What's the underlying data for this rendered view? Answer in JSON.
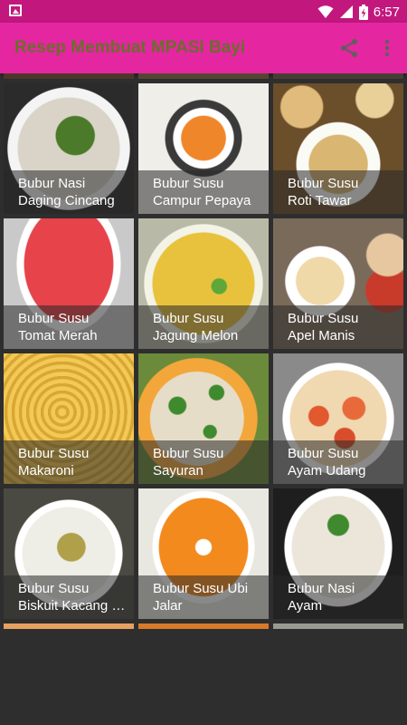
{
  "status_bar": {
    "time": "6:57",
    "icons": [
      "image-notification-icon",
      "wifi-icon",
      "signal-icon",
      "battery-charging-icon"
    ]
  },
  "app_bar": {
    "title": "Resep Membuat MPASI Bayi",
    "actions": [
      "share-icon",
      "more-vert-icon"
    ]
  },
  "colors": {
    "status_bar": "#c2187e",
    "app_bar": "#e426a1",
    "title_text": "#6d6c2e",
    "background": "#2e2e2e"
  },
  "recipes": [
    {
      "line1": "Bubur Nasi",
      "line2": "Daging Cincang"
    },
    {
      "line1": "Bubur Susu",
      "line2": "Campur Pepaya"
    },
    {
      "line1": "Bubur Susu",
      "line2": "Roti Tawar"
    },
    {
      "line1": "Bubur Susu",
      "line2": "Tomat Merah"
    },
    {
      "line1": "Bubur Susu",
      "line2": "Jagung Melon"
    },
    {
      "line1": "Bubur Susu",
      "line2": "Apel Manis"
    },
    {
      "line1": "Bubur Susu",
      "line2": "Makaroni"
    },
    {
      "line1": "Bubur Susu",
      "line2": "Sayuran"
    },
    {
      "line1": "Bubur Susu",
      "line2": "Ayam Udang"
    },
    {
      "line1": "Bubur Susu",
      "line2": "Biskuit Kacang Hijau"
    },
    {
      "line1": "Bubur Susu Ubi",
      "line2": "Jalar"
    },
    {
      "line1": "Bubur Nasi",
      "line2": "Ayam"
    }
  ]
}
